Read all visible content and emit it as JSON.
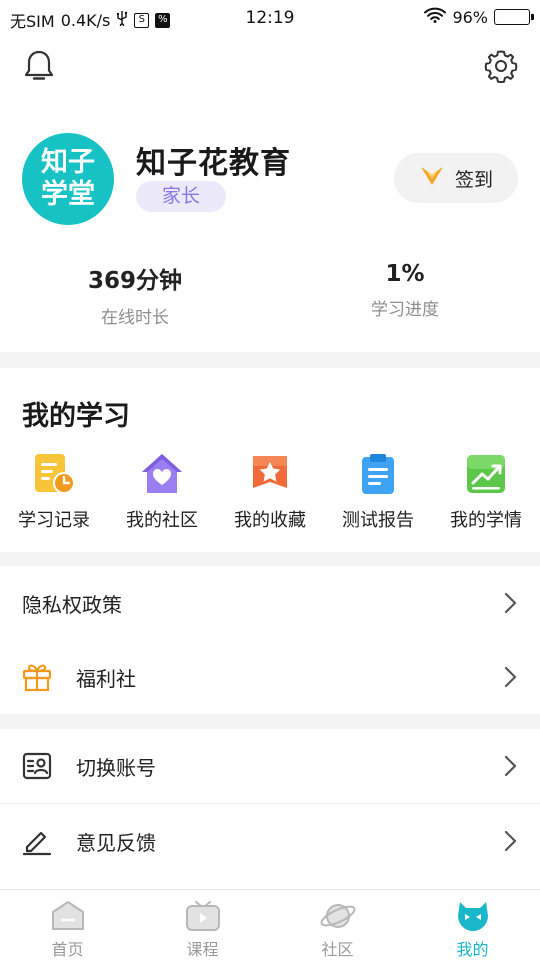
{
  "status_bar": {
    "carrier": "无SIM",
    "speed": "0.4K/s",
    "time": "12:19",
    "battery": "96%"
  },
  "icons": {
    "bell": "bell-icon",
    "settings": "gear-icon"
  },
  "profile": {
    "avatar_line1": "知子",
    "avatar_line2": "学堂",
    "name": "知子花教育",
    "role": "家长",
    "checkin_label": "签到"
  },
  "stats": [
    {
      "value": "369分钟",
      "label": "在线时长"
    },
    {
      "value": "1%",
      "label": "学习进度"
    }
  ],
  "my_study": {
    "title": "我的学习",
    "items": [
      {
        "label": "学习记录",
        "icon": "study-record-icon"
      },
      {
        "label": "我的社区",
        "icon": "community-home-icon"
      },
      {
        "label": "我的收藏",
        "icon": "favorites-star-icon"
      },
      {
        "label": "测试报告",
        "icon": "test-report-clipboard-icon"
      },
      {
        "label": "我的学情",
        "icon": "learning-trend-icon"
      }
    ]
  },
  "menu": {
    "privacy": "隐私权政策",
    "welfare": "福利社",
    "switch_account": "切换账号",
    "feedback": "意见反馈"
  },
  "tabs": [
    {
      "label": "首页",
      "icon": "home-icon"
    },
    {
      "label": "课程",
      "icon": "course-tv-icon"
    },
    {
      "label": "社区",
      "icon": "planet-icon"
    },
    {
      "label": "我的",
      "icon": "mine-face-icon",
      "active": true
    }
  ],
  "colors": {
    "accent": "#19b7c9",
    "avatar_bg": "#16c2c4",
    "role_badge_text": "#8a76e0",
    "checkin_icon": "#f5a623"
  }
}
